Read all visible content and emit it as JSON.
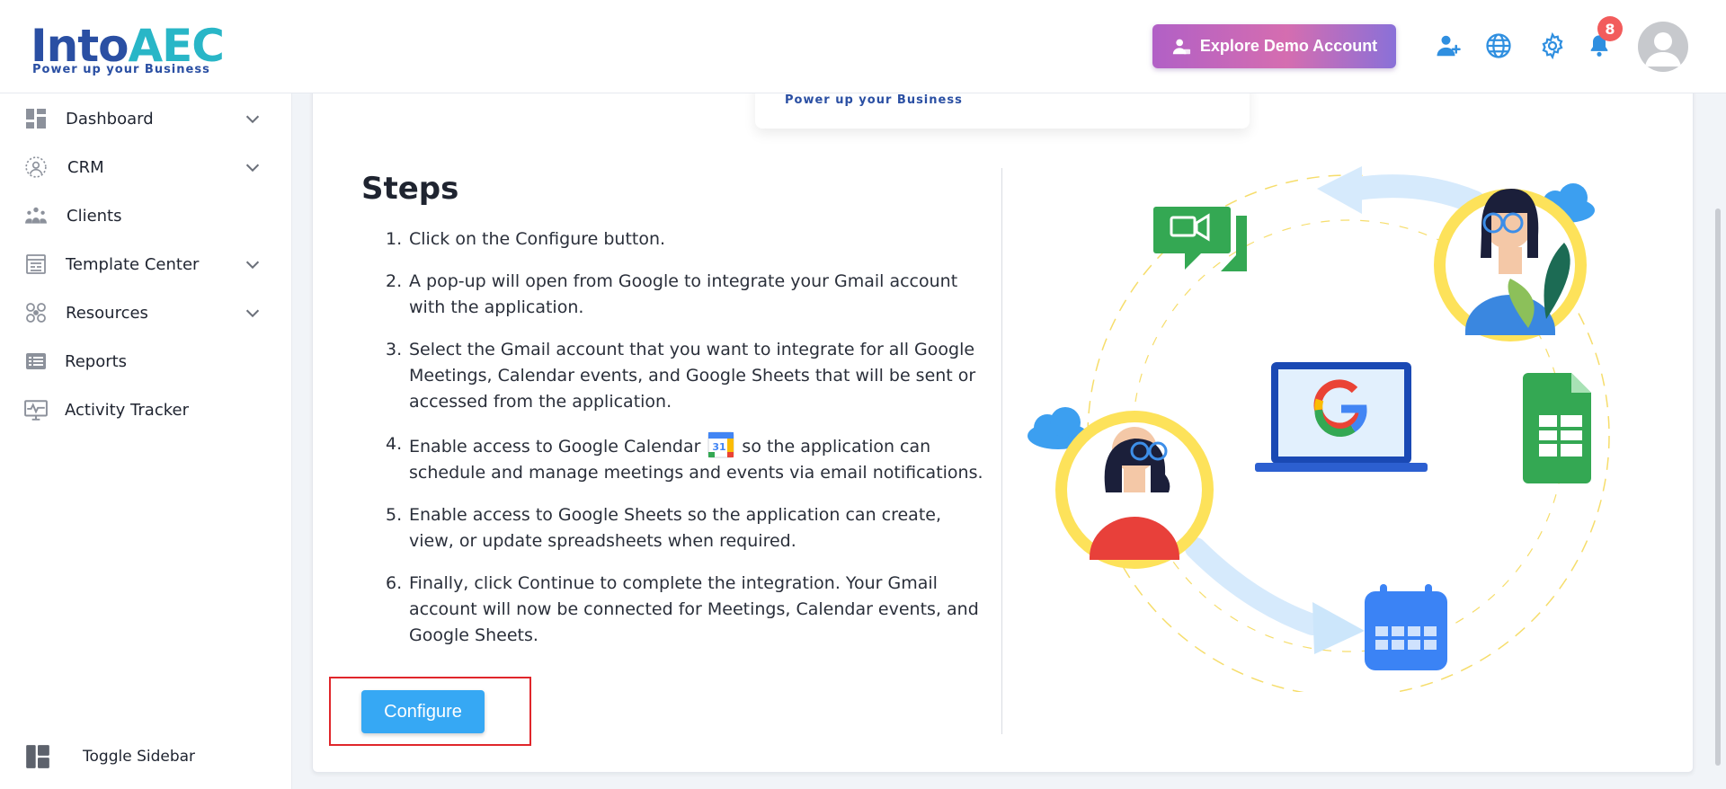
{
  "brand": {
    "logo_part1": "Into",
    "logo_part2": "AEC",
    "tagline": "Power up your Business"
  },
  "header": {
    "demo_button_label": "Explore Demo Account",
    "notification_count": "8"
  },
  "sidebar": {
    "items": [
      {
        "label": "Dashboard",
        "icon": "dashboard-icon",
        "expandable": true
      },
      {
        "label": "CRM",
        "icon": "crm-icon",
        "expandable": true
      },
      {
        "label": "Clients",
        "icon": "clients-icon",
        "expandable": false
      },
      {
        "label": "Template Center",
        "icon": "template-icon",
        "expandable": true
      },
      {
        "label": "Resources",
        "icon": "resources-icon",
        "expandable": true
      },
      {
        "label": "Reports",
        "icon": "reports-icon",
        "expandable": false
      },
      {
        "label": "Activity Tracker",
        "icon": "activity-icon",
        "expandable": false
      }
    ],
    "toggle_label": "Toggle Sidebar"
  },
  "content": {
    "logo_card_tagline": "Power up your Business",
    "steps_title": "Steps",
    "steps": [
      {
        "num": "1.",
        "text": "Click on the Configure button."
      },
      {
        "num": "2.",
        "text": "A pop-up will open from Google to integrate your Gmail account with the application."
      },
      {
        "num": "3.",
        "text": "Select the Gmail account that you want to integrate for all Google Meetings, Calendar events, and Google Sheets that will be sent or accessed from the application."
      },
      {
        "num": "4.",
        "text_before": "Enable access to Google Calendar",
        "text_after": "so the application can schedule and manage meetings and events via email notifications.",
        "calendar_day": "31"
      },
      {
        "num": "5.",
        "text": "Enable access to Google Sheets so the application can create, view, or update spreadsheets when required."
      },
      {
        "num": "6.",
        "text": "Finally, click Continue to complete the integration. Your Gmail account will now be connected for Meetings, Calendar events, and Google Sheets."
      }
    ],
    "configure_label": "Configure"
  },
  "colors": {
    "primary_blue": "#36a8f4",
    "header_icon_blue": "#2f8fe0",
    "highlight_red": "#e0262b",
    "badge_red": "#f25c5c"
  }
}
